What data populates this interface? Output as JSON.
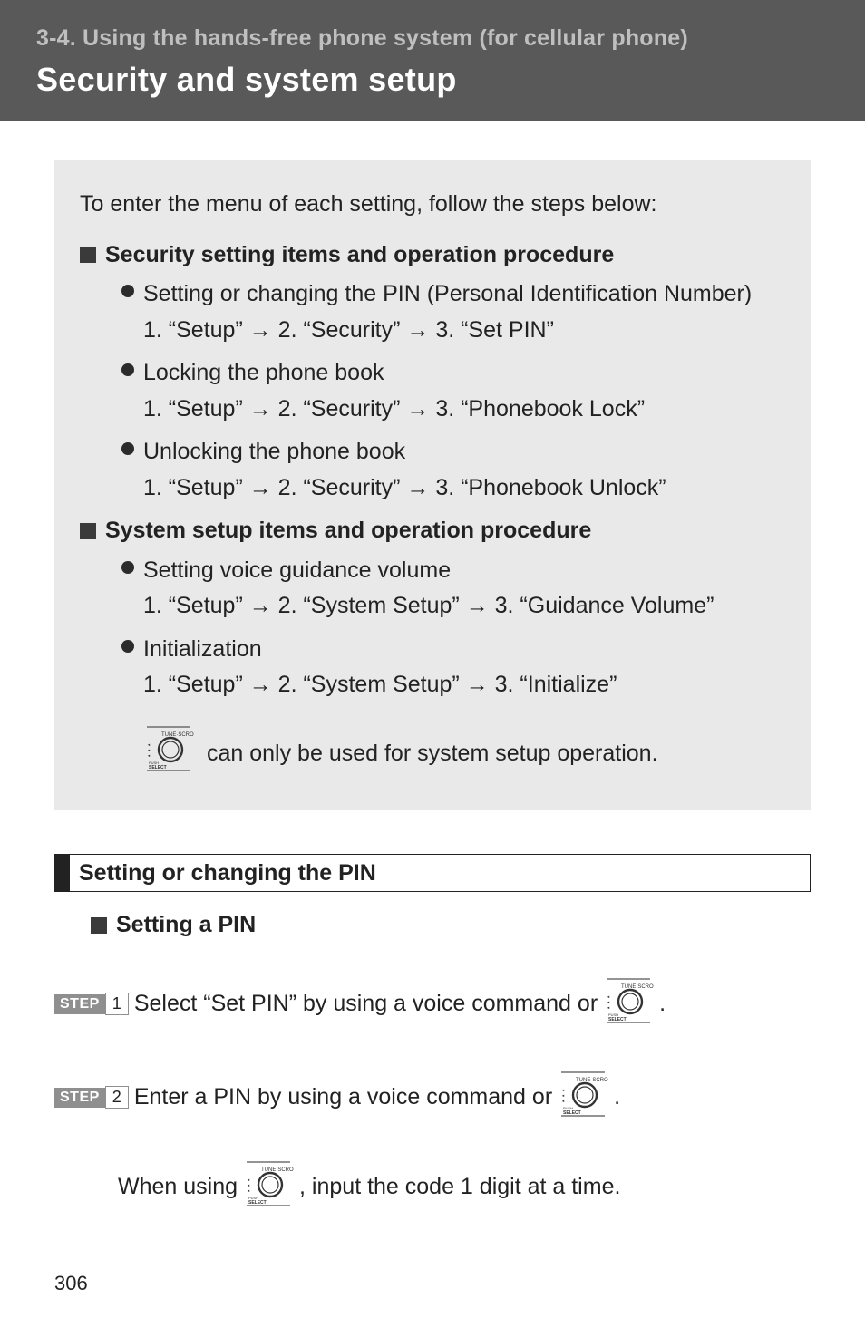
{
  "header": {
    "section": "3-4. Using the hands-free phone system (for cellular phone)",
    "title": "Security and system setup"
  },
  "intro": "To enter the menu of each setting, follow the steps below:",
  "groups": [
    {
      "title": "Security setting items and operation procedure",
      "items": [
        {
          "title": "Setting or changing the PIN (Personal Identification Number)",
          "path": "1. “Setup” → 2. “Security” → 3. “Set PIN”"
        },
        {
          "title": "Locking the phone book",
          "path": "1. “Setup” → 2. “Security” → 3. “Phonebook Lock”"
        },
        {
          "title": "Unlocking the phone book",
          "path": "1. “Setup” → 2. “Security” → 3. “Phonebook Unlock”"
        }
      ]
    },
    {
      "title": "System setup items and operation procedure",
      "items": [
        {
          "title": "Setting voice guidance volume",
          "path": "1. “Setup” → 2. “System Setup” → 3. “Guidance Volume”"
        },
        {
          "title": "Initialization",
          "path": "1. “Setup” → 2. “System Setup” → 3. “Initialize”"
        }
      ]
    }
  ],
  "knob_note": " can only be used for system setup operation.",
  "section2_title": "Setting or changing the PIN",
  "sub_title": "Setting a PIN",
  "steps": [
    {
      "badge_left": "STEP",
      "badge_right": "1",
      "text_before": "Select “Set PIN” by using a voice command or ",
      "text_after": "."
    },
    {
      "badge_left": "STEP",
      "badge_right": "2",
      "text_before": "Enter a PIN by using a voice command or ",
      "text_after": "."
    }
  ],
  "when_row": {
    "before": "When using ",
    "after": ", input the code 1 digit at a time."
  },
  "knob_labels": {
    "top": "TUNE·SCROLL",
    "bottom": "SELECT",
    "push": "PUSH"
  },
  "page_number": "306"
}
